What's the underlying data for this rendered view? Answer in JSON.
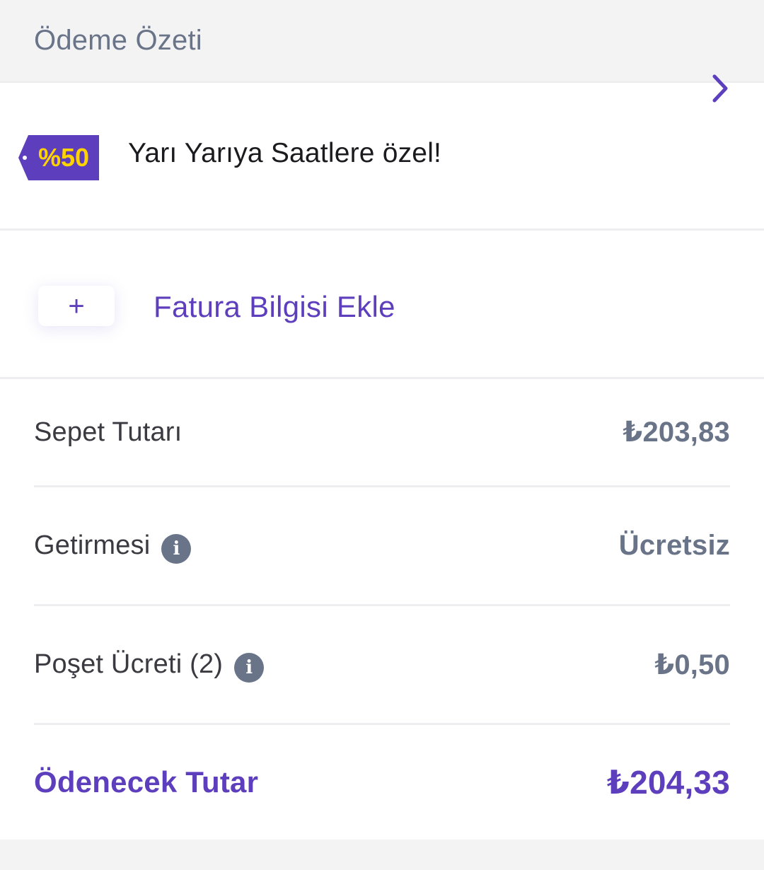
{
  "header": {
    "title": "Ödeme Özeti"
  },
  "promo": {
    "tag_text": "%50",
    "text": "Yarı Yarıya Saatlere özel!",
    "tag_bg_color": "#5d3ebc",
    "tag_text_color": "#ffd300",
    "chevron_icon": "chevron-right-icon"
  },
  "invoice": {
    "plus_symbol": "+",
    "label": "Fatura Bilgisi Ekle"
  },
  "summary": {
    "rows": [
      {
        "label": "Sepet Tutarı",
        "value": "₺203,83",
        "info": false
      },
      {
        "label": "Getirmesi",
        "value": "Ücretsiz",
        "info": true
      },
      {
        "label": "Poşet Ücreti (2)",
        "value": "₺0,50",
        "info": true
      }
    ],
    "total": {
      "label": "Ödenecek Tutar",
      "value": "₺204,33"
    },
    "info_icon_glyph": "i"
  },
  "colors": {
    "accent": "#5d3ebc",
    "muted": "#697488",
    "promo_yellow": "#ffd300"
  }
}
